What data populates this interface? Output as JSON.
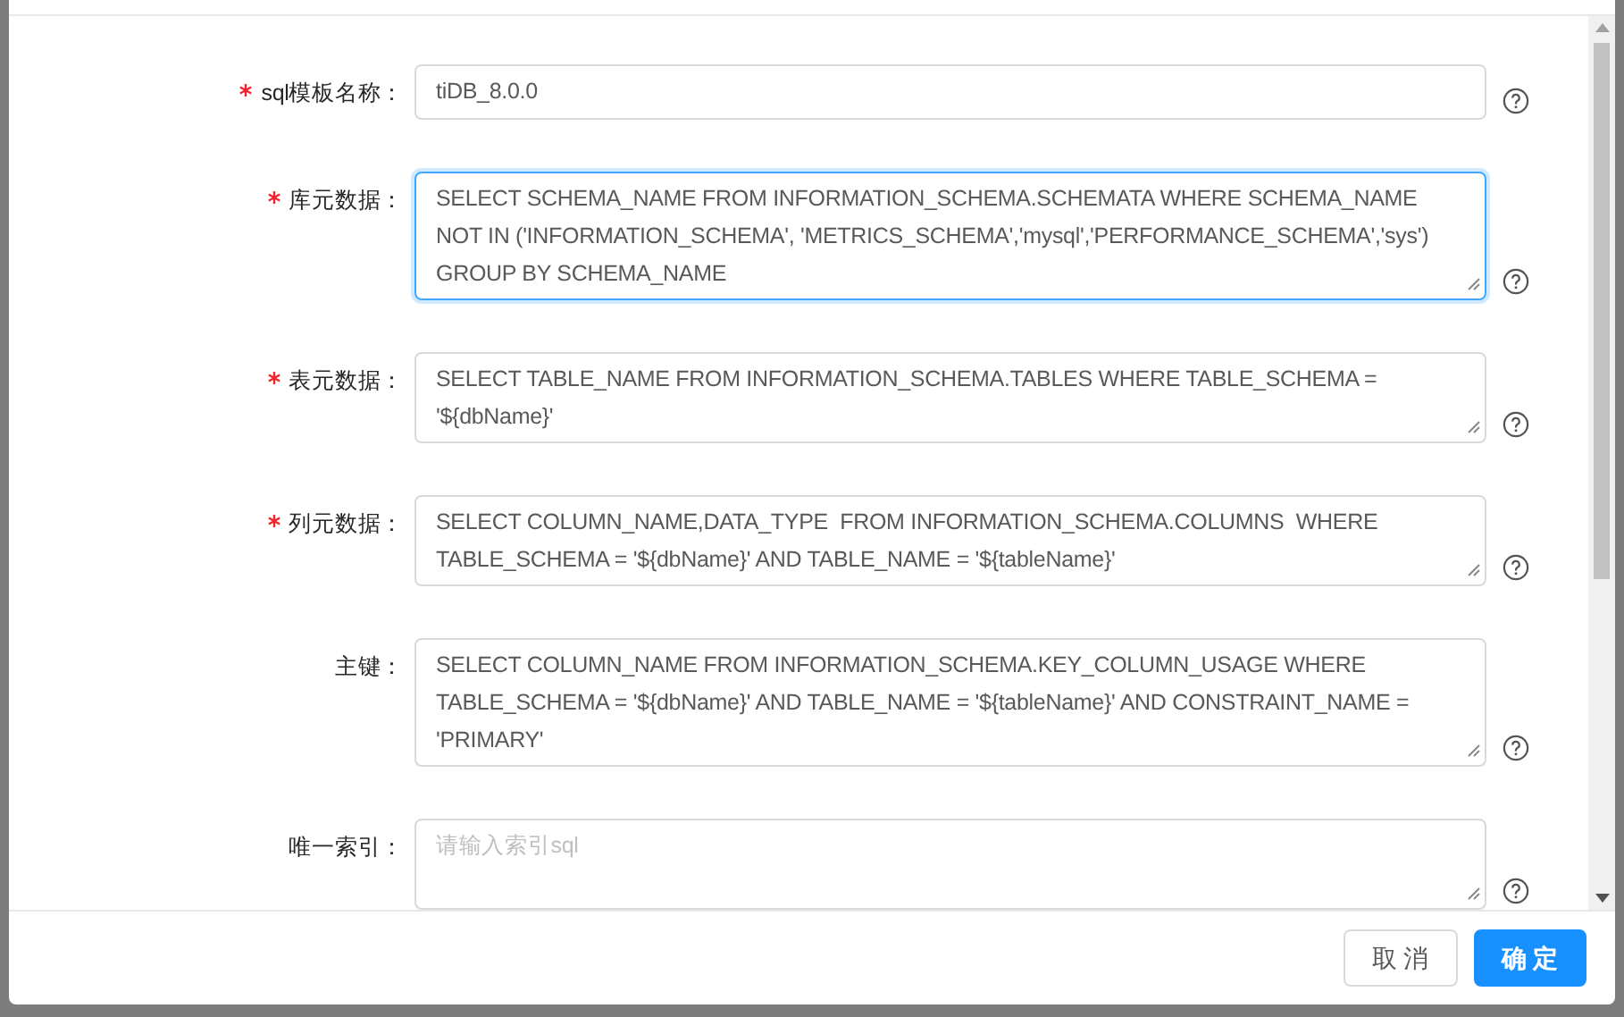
{
  "form": {
    "fields": [
      {
        "label": "sql模板名称：",
        "required": true,
        "kind": "input",
        "focused": false,
        "value": "tiDB_8.0.0"
      },
      {
        "label": "库元数据：",
        "required": true,
        "kind": "textarea",
        "focused": true,
        "value": "SELECT SCHEMA_NAME FROM INFORMATION_SCHEMA.SCHEMATA WHERE SCHEMA_NAME NOT IN ('INFORMATION_SCHEMA', 'METRICS_SCHEMA','mysql','PERFORMANCE_SCHEMA','sys') GROUP BY SCHEMA_NAME"
      },
      {
        "label": "表元数据：",
        "required": true,
        "kind": "textarea",
        "focused": false,
        "value": "SELECT TABLE_NAME FROM INFORMATION_SCHEMA.TABLES WHERE TABLE_SCHEMA = '${dbName}'"
      },
      {
        "label": "列元数据：",
        "required": true,
        "kind": "textarea",
        "focused": false,
        "value": "SELECT COLUMN_NAME,DATA_TYPE  FROM INFORMATION_SCHEMA.COLUMNS  WHERE TABLE_SCHEMA = '${dbName}' AND TABLE_NAME = '${tableName}'"
      },
      {
        "label": "主键：",
        "required": false,
        "kind": "textarea",
        "focused": false,
        "value": "SELECT COLUMN_NAME FROM INFORMATION_SCHEMA.KEY_COLUMN_USAGE WHERE TABLE_SCHEMA = '${dbName}' AND TABLE_NAME = '${tableName}' AND CONSTRAINT_NAME = 'PRIMARY'"
      },
      {
        "label": "唯一索引：",
        "required": false,
        "kind": "textarea",
        "focused": false,
        "placeholder": "请输入索引sql"
      }
    ]
  },
  "footer": {
    "buttons": [
      {
        "label": "取 消",
        "kind": "default"
      },
      {
        "label": "确 定",
        "kind": "primary"
      }
    ]
  }
}
